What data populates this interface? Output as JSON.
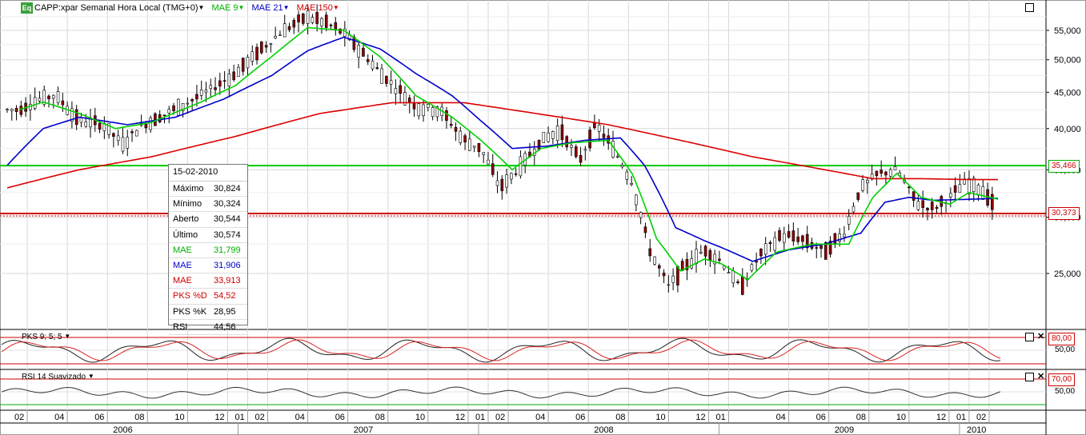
{
  "header": {
    "icon_label": "Eq",
    "title": "CAPP:xpar Semanal Hora Local (TMG+0)",
    "studies": [
      {
        "label": "MAE 9",
        "color": "#00c000"
      },
      {
        "label": "MAE 21",
        "color": "#0000cc"
      },
      {
        "label": "MAE 150",
        "color": "#cc0000"
      }
    ]
  },
  "price_labels": {
    "upper": "35,466",
    "lower": "30,373"
  },
  "tooltip": {
    "date": "15-02-2010",
    "rows": [
      {
        "k": "Máximo",
        "v": "30,824",
        "color": "#000000"
      },
      {
        "k": "Mínimo",
        "v": "30,324",
        "color": "#000000"
      },
      {
        "k": "Aberto",
        "v": "30,544",
        "color": "#000000"
      },
      {
        "k": "Último",
        "v": "30,574",
        "color": "#000000"
      },
      {
        "k": "MAE",
        "v": "31,799",
        "color": "#00b000"
      },
      {
        "k": "MAE",
        "v": "31,906",
        "color": "#0000cc"
      },
      {
        "k": "MAE",
        "v": "33,913",
        "color": "#cc0000"
      },
      {
        "k": "PKS %D",
        "v": "54,52",
        "color": "#cc0000"
      },
      {
        "k": "PKS %K",
        "v": "28,95",
        "color": "#000000"
      },
      {
        "k": "RSI",
        "v": "44,56",
        "color": "#000000"
      }
    ]
  },
  "stoch_panel": {
    "title": "PKS 9; 5; 5",
    "level_label": "80,00",
    "mid_label": "50,00"
  },
  "rsi_panel": {
    "title": "RSI 14 Suavizado",
    "level_label": "70,00",
    "mid_label": "50,00"
  },
  "chart_data": {
    "type": "candlestick",
    "y_ticks": [
      25000,
      30000,
      35000,
      40000,
      45000,
      50000,
      55000
    ],
    "y_tick_labels": [
      "25,000",
      "30,000",
      "35,000",
      "40,000",
      "45,000",
      "50,000",
      "55,000"
    ],
    "horizontal_levels": [
      35.466,
      30.373
    ],
    "months": [
      "02",
      "04",
      "06",
      "08",
      "10",
      "12",
      "01",
      "02",
      "04",
      "06",
      "08",
      "10",
      "12",
      "01",
      "02",
      "04",
      "06",
      "08",
      "10",
      "12",
      "01",
      "04",
      "06",
      "08",
      "10",
      "12",
      "01",
      "02"
    ],
    "years": [
      "2006",
      "2007",
      "2008",
      "2009",
      "2010"
    ],
    "close_path": [
      [
        2006.05,
        42.5
      ],
      [
        2006.12,
        43.8
      ],
      [
        2006.2,
        44.6
      ],
      [
        2006.3,
        41.0
      ],
      [
        2006.4,
        40.5
      ],
      [
        2006.48,
        38.0
      ],
      [
        2006.55,
        40.2
      ],
      [
        2006.65,
        41.8
      ],
      [
        2006.75,
        43.5
      ],
      [
        2006.85,
        45.5
      ],
      [
        2006.95,
        47.8
      ],
      [
        2007.05,
        51.5
      ],
      [
        2007.15,
        55.0
      ],
      [
        2007.25,
        57.5
      ],
      [
        2007.33,
        56.2
      ],
      [
        2007.4,
        54.5
      ],
      [
        2007.48,
        51.0
      ],
      [
        2007.55,
        48.0
      ],
      [
        2007.63,
        45.2
      ],
      [
        2007.7,
        43.0
      ],
      [
        2007.8,
        42.5
      ],
      [
        2007.9,
        38.5
      ],
      [
        2007.97,
        37.5
      ],
      [
        2008.05,
        33.0
      ],
      [
        2008.13,
        35.2
      ],
      [
        2008.22,
        38.5
      ],
      [
        2008.3,
        39.8
      ],
      [
        2008.38,
        36.0
      ],
      [
        2008.45,
        40.5
      ],
      [
        2008.53,
        37.0
      ],
      [
        2008.6,
        33.5
      ],
      [
        2008.67,
        27.0
      ],
      [
        2008.75,
        24.0
      ],
      [
        2008.83,
        25.8
      ],
      [
        2008.9,
        27.0
      ],
      [
        2008.97,
        26.0
      ],
      [
        2009.05,
        23.8
      ],
      [
        2009.13,
        26.5
      ],
      [
        2009.22,
        28.3
      ],
      [
        2009.3,
        28.0
      ],
      [
        2009.4,
        26.8
      ],
      [
        2009.48,
        28.5
      ],
      [
        2009.55,
        33.0
      ],
      [
        2009.62,
        34.5
      ],
      [
        2009.7,
        35.0
      ],
      [
        2009.78,
        31.5
      ],
      [
        2009.85,
        30.8
      ],
      [
        2009.92,
        32.0
      ],
      [
        2009.98,
        33.5
      ],
      [
        2010.05,
        33.0
      ],
      [
        2010.12,
        30.6
      ]
    ],
    "ma9_path": [
      [
        2006.05,
        42.5
      ],
      [
        2006.15,
        43.6
      ],
      [
        2006.3,
        42.0
      ],
      [
        2006.45,
        40.0
      ],
      [
        2006.6,
        40.8
      ],
      [
        2006.8,
        43.5
      ],
      [
        2006.95,
        46.0
      ],
      [
        2007.1,
        50.5
      ],
      [
        2007.25,
        55.5
      ],
      [
        2007.4,
        55.0
      ],
      [
        2007.55,
        50.5
      ],
      [
        2007.7,
        44.5
      ],
      [
        2007.85,
        41.5
      ],
      [
        2007.97,
        38.5
      ],
      [
        2008.1,
        35.0
      ],
      [
        2008.22,
        37.5
      ],
      [
        2008.35,
        38.2
      ],
      [
        2008.5,
        38.5
      ],
      [
        2008.6,
        34.5
      ],
      [
        2008.7,
        28.0
      ],
      [
        2008.8,
        25.2
      ],
      [
        2008.9,
        26.2
      ],
      [
        2008.97,
        25.8
      ],
      [
        2009.08,
        24.5
      ],
      [
        2009.2,
        26.8
      ],
      [
        2009.35,
        27.5
      ],
      [
        2009.5,
        27.5
      ],
      [
        2009.6,
        32.0
      ],
      [
        2009.7,
        34.6
      ],
      [
        2009.8,
        32.0
      ],
      [
        2009.92,
        31.3
      ],
      [
        2010.0,
        32.5
      ],
      [
        2010.12,
        31.8
      ]
    ],
    "ma21_path": [
      [
        2006.0,
        35.5
      ],
      [
        2006.15,
        40.0
      ],
      [
        2006.3,
        41.5
      ],
      [
        2006.5,
        40.5
      ],
      [
        2006.7,
        41.5
      ],
      [
        2006.9,
        44.0
      ],
      [
        2007.1,
        47.5
      ],
      [
        2007.25,
        51.5
      ],
      [
        2007.4,
        53.8
      ],
      [
        2007.55,
        51.8
      ],
      [
        2007.7,
        47.8
      ],
      [
        2007.85,
        44.5
      ],
      [
        2007.97,
        41.0
      ],
      [
        2008.1,
        37.5
      ],
      [
        2008.25,
        37.8
      ],
      [
        2008.4,
        38.5
      ],
      [
        2008.55,
        38.8
      ],
      [
        2008.65,
        35.5
      ],
      [
        2008.78,
        29.0
      ],
      [
        2008.9,
        27.8
      ],
      [
        2008.97,
        27.2
      ],
      [
        2009.1,
        26.0
      ],
      [
        2009.25,
        27.0
      ],
      [
        2009.4,
        27.5
      ],
      [
        2009.55,
        28.5
      ],
      [
        2009.65,
        31.5
      ],
      [
        2009.75,
        32.0
      ],
      [
        2009.85,
        31.7
      ],
      [
        2010.0,
        31.8
      ],
      [
        2010.12,
        31.9
      ]
    ],
    "ma150_path": [
      [
        2006.0,
        33.0
      ],
      [
        2006.3,
        35.0
      ],
      [
        2006.6,
        36.5
      ],
      [
        2006.95,
        39.0
      ],
      [
        2007.3,
        42.0
      ],
      [
        2007.6,
        43.5
      ],
      [
        2007.9,
        43.5
      ],
      [
        2008.2,
        42.0
      ],
      [
        2008.5,
        40.5
      ],
      [
        2008.8,
        38.5
      ],
      [
        2009.1,
        36.5
      ],
      [
        2009.4,
        35.0
      ],
      [
        2009.6,
        34.0
      ],
      [
        2009.8,
        34.0
      ],
      [
        2010.0,
        33.9
      ],
      [
        2010.12,
        33.9
      ]
    ]
  }
}
